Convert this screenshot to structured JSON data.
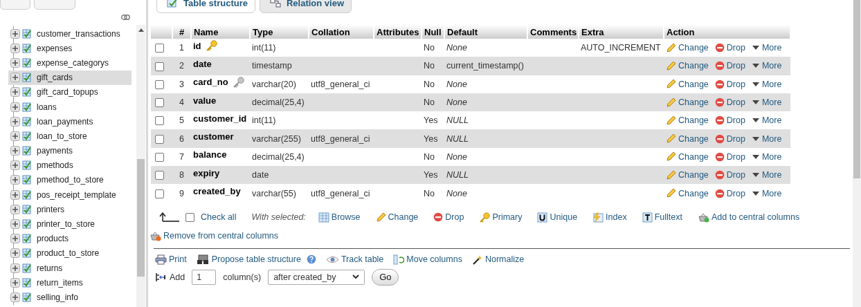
{
  "sidebar": {
    "items": [
      {
        "label": "customer_transactions",
        "selected": false
      },
      {
        "label": "expenses",
        "selected": false
      },
      {
        "label": "expense_categorys",
        "selected": false
      },
      {
        "label": "gift_cards",
        "selected": true
      },
      {
        "label": "gift_card_topups",
        "selected": false
      },
      {
        "label": "loans",
        "selected": false
      },
      {
        "label": "loan_payments",
        "selected": false
      },
      {
        "label": "loan_to_store",
        "selected": false
      },
      {
        "label": "payments",
        "selected": false
      },
      {
        "label": "pmethods",
        "selected": false
      },
      {
        "label": "pmethod_to_store",
        "selected": false
      },
      {
        "label": "pos_receipt_template",
        "selected": false
      },
      {
        "label": "printers",
        "selected": false
      },
      {
        "label": "printer_to_store",
        "selected": false
      },
      {
        "label": "products",
        "selected": false
      },
      {
        "label": "product_to_store",
        "selected": false
      },
      {
        "label": "returns",
        "selected": false
      },
      {
        "label": "return_items",
        "selected": false
      },
      {
        "label": "selling_info",
        "selected": false
      }
    ]
  },
  "tabs": [
    {
      "kind": "structure",
      "label": "Table structure",
      "selected": true
    },
    {
      "kind": "relation",
      "label": "Relation view",
      "selected": false
    }
  ],
  "table": {
    "columns": [
      "#",
      "Name",
      "Type",
      "Collation",
      "Attributes",
      "Null",
      "Default",
      "Comments",
      "Extra",
      "Action"
    ],
    "rows": [
      {
        "kind": "primary",
        "num": "1",
        "name": "id",
        "type": "int(11)",
        "null": "No",
        "default": "None",
        "default_keyword": true,
        "extra": "AUTO_INCREMENT",
        "checked": false,
        "actions": [
          {
            "kind": "change",
            "label": "Change"
          },
          {
            "kind": "drop",
            "label": "Drop"
          },
          {
            "kind": "more",
            "label": "More"
          }
        ]
      },
      {
        "kind": "plain",
        "num": "2",
        "name": "date",
        "type": "timestamp",
        "null": "No",
        "default": "current_timestamp()",
        "default_keyword": false,
        "checked": false,
        "actions": [
          {
            "kind": "change",
            "label": "Change"
          },
          {
            "kind": "drop",
            "label": "Drop"
          },
          {
            "kind": "more",
            "label": "More"
          }
        ]
      },
      {
        "kind": "unique",
        "num": "3",
        "name": "card_no",
        "type": "varchar(20)",
        "collation": "utf8_general_ci",
        "null": "No",
        "default": "None",
        "default_keyword": true,
        "checked": false,
        "actions": [
          {
            "kind": "change",
            "label": "Change"
          },
          {
            "kind": "drop",
            "label": "Drop"
          },
          {
            "kind": "more",
            "label": "More"
          }
        ]
      },
      {
        "kind": "plain",
        "num": "4",
        "name": "value",
        "type": "decimal(25,4)",
        "null": "No",
        "default": "None",
        "default_keyword": true,
        "checked": false,
        "actions": [
          {
            "kind": "change",
            "label": "Change"
          },
          {
            "kind": "drop",
            "label": "Drop"
          },
          {
            "kind": "more",
            "label": "More"
          }
        ]
      },
      {
        "kind": "plain",
        "num": "5",
        "name": "customer_id",
        "type": "int(11)",
        "null": "Yes",
        "default": "NULL",
        "default_keyword": true,
        "checked": false,
        "actions": [
          {
            "kind": "change",
            "label": "Change"
          },
          {
            "kind": "drop",
            "label": "Drop"
          },
          {
            "kind": "more",
            "label": "More"
          }
        ]
      },
      {
        "kind": "plain",
        "num": "6",
        "name": "customer",
        "type": "varchar(255)",
        "collation": "utf8_general_ci",
        "null": "Yes",
        "default": "NULL",
        "default_keyword": true,
        "checked": false,
        "actions": [
          {
            "kind": "change",
            "label": "Change"
          },
          {
            "kind": "drop",
            "label": "Drop"
          },
          {
            "kind": "more",
            "label": "More"
          }
        ]
      },
      {
        "kind": "plain",
        "num": "7",
        "name": "balance",
        "type": "decimal(25,4)",
        "null": "No",
        "default": "None",
        "default_keyword": true,
        "checked": false,
        "actions": [
          {
            "kind": "change",
            "label": "Change"
          },
          {
            "kind": "drop",
            "label": "Drop"
          },
          {
            "kind": "more",
            "label": "More"
          }
        ]
      },
      {
        "kind": "plain",
        "num": "8",
        "name": "expiry",
        "type": "date",
        "null": "Yes",
        "default": "NULL",
        "default_keyword": true,
        "checked": false,
        "actions": [
          {
            "kind": "change",
            "label": "Change"
          },
          {
            "kind": "drop",
            "label": "Drop"
          },
          {
            "kind": "more",
            "label": "More"
          }
        ]
      },
      {
        "kind": "plain",
        "num": "9",
        "name": "created_by",
        "type": "varchar(55)",
        "collation": "utf8_general_ci",
        "null": "No",
        "default": "None",
        "default_keyword": true,
        "checked": false,
        "actions": [
          {
            "kind": "change",
            "label": "Change"
          },
          {
            "kind": "drop",
            "label": "Drop"
          },
          {
            "kind": "more",
            "label": "More"
          }
        ]
      }
    ]
  },
  "bulk": {
    "check_all": "Check all",
    "checked": false,
    "with_selected": "With selected:",
    "actions": [
      {
        "kind": "browse",
        "label": "Browse"
      },
      {
        "kind": "change",
        "label": "Change"
      },
      {
        "kind": "drop",
        "label": "Drop"
      },
      {
        "kind": "primary",
        "label": "Primary"
      },
      {
        "kind": "unique",
        "label": "Unique"
      },
      {
        "kind": "index",
        "label": "Index"
      },
      {
        "kind": "fulltext",
        "label": "Fulltext"
      },
      {
        "kind": "add_central",
        "label": "Add to central columns"
      },
      {
        "kind": "remove_central",
        "label": "Remove from central columns"
      }
    ]
  },
  "tools": [
    {
      "kind": "print",
      "label": "Print",
      "help": false
    },
    {
      "kind": "propose",
      "label": "Propose table structure",
      "help": true
    },
    {
      "kind": "track",
      "label": "Track table",
      "help": false
    },
    {
      "kind": "move",
      "label": "Move columns",
      "help": false
    },
    {
      "kind": "normalize",
      "label": "Normalize",
      "help": false
    }
  ],
  "add_columns": {
    "label": "Add",
    "count": "1",
    "unit": "column(s)",
    "position": "after created_by",
    "button": "Go"
  }
}
